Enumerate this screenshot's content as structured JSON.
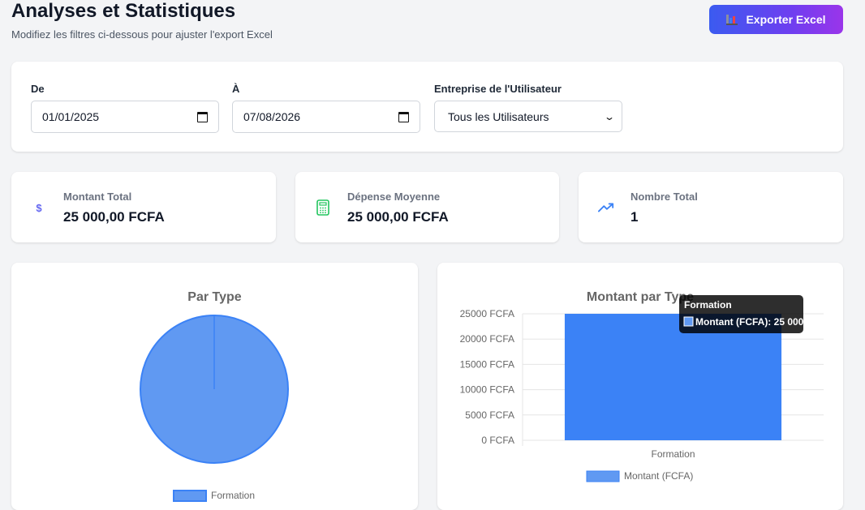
{
  "header": {
    "title": "Analyses et Statistiques",
    "subtitle": "Modifiez les filtres ci-dessous pour ajuster l'export Excel",
    "export_label": "Exporter Excel"
  },
  "filters": {
    "from_label": "De",
    "from_value": "01/01/2025",
    "to_label": "À",
    "to_value": "07/08/2026",
    "company_label": "Entreprise de l'Utilisateur",
    "company_value": "Tous les Utilisateurs"
  },
  "stats": [
    {
      "label": "Montant Total",
      "value": "25 000,00 FCFA",
      "icon": "dollar-icon",
      "color": "#6366f1"
    },
    {
      "label": "Dépense Moyenne",
      "value": "25 000,00 FCFA",
      "icon": "calculator-icon",
      "color": "#22c55e"
    },
    {
      "label": "Nombre Total",
      "value": "1",
      "icon": "trending-up-icon",
      "color": "#3b82f6"
    }
  ],
  "chart_data": [
    {
      "type": "pie",
      "title": "Par Type",
      "categories": [
        "Formation"
      ],
      "values": [
        25000
      ],
      "colors": [
        "#6099f2"
      ],
      "legend": "bottom"
    },
    {
      "type": "bar",
      "title": "Montant par Type",
      "categories": [
        "Formation"
      ],
      "series": [
        {
          "name": "Montant (FCFA)",
          "values": [
            25000
          ]
        }
      ],
      "y_ticks": [
        "25000 FCFA",
        "20000 FCFA",
        "15000 FCFA",
        "10000 FCFA",
        "5000 FCFA",
        "0 FCFA"
      ],
      "ylim": [
        0,
        25000
      ],
      "grid": true,
      "legend": "bottom",
      "tooltip": {
        "title": "Formation",
        "text": "Montant (FCFA): 25 000"
      }
    }
  ]
}
